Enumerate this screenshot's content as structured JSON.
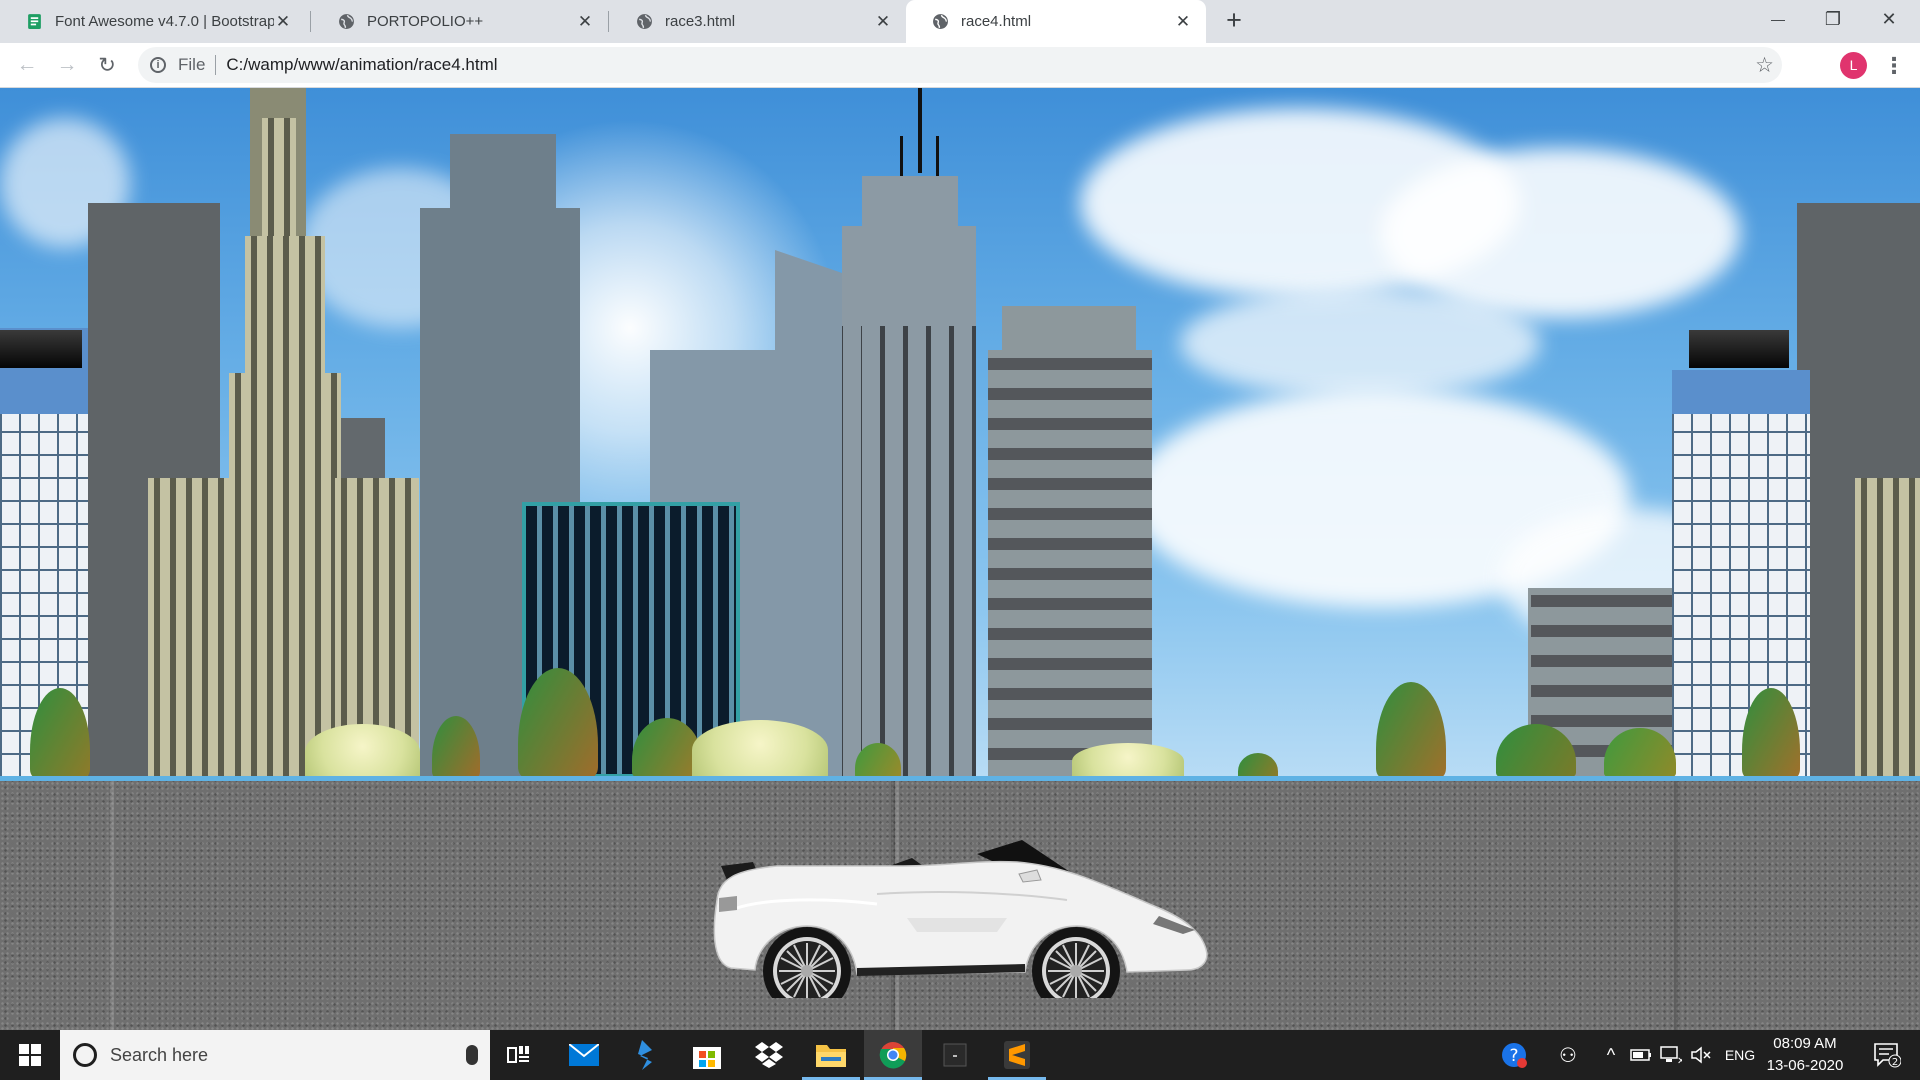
{
  "browser": {
    "tabs": [
      {
        "title": "Font Awesome v4.7.0 | Bootstrap",
        "close": "✕",
        "active": false,
        "favicon": "document-icon"
      },
      {
        "title": "PORTOPOLIO++",
        "close": "✕",
        "active": false,
        "favicon": "globe-icon"
      },
      {
        "title": "race3.html",
        "close": "✕",
        "active": false,
        "favicon": "globe-icon"
      },
      {
        "title": "race4.html",
        "close": "✕",
        "active": true,
        "favicon": "globe-icon"
      }
    ],
    "new_tab": "+",
    "window": {
      "minimize": "—",
      "maximize": "❐",
      "close": "✕"
    },
    "nav": {
      "back": "←",
      "forward": "→",
      "reload": "↻"
    },
    "omnibox": {
      "info": "i",
      "scheme": "File",
      "url": "C:/wamp/www/animation/race4.html",
      "star": "☆"
    },
    "profile_initial": "L",
    "menu": "⋮"
  },
  "scene": {
    "description_icons": [
      "city-skyline",
      "car-icon",
      "road"
    ],
    "colors": {
      "sky": "#3f8fd8",
      "road": "#6f6f6f",
      "road_edge": "#5fb2e4",
      "car": "#f2f2f2"
    }
  },
  "taskbar": {
    "search_placeholder": "Search here",
    "apps": [
      "task-view-icon",
      "mail-icon",
      "visual-studio-icon",
      "store-icon",
      "dropbox-icon",
      "file-explorer-icon",
      "chrome-icon",
      "terminal-icon",
      "sublime-text-icon"
    ],
    "tray": {
      "help": "?",
      "people": "⚇",
      "chevron": "^",
      "language": "ENG",
      "notifications": "2"
    },
    "time": "08:09 AM",
    "date": "13-06-2020"
  }
}
